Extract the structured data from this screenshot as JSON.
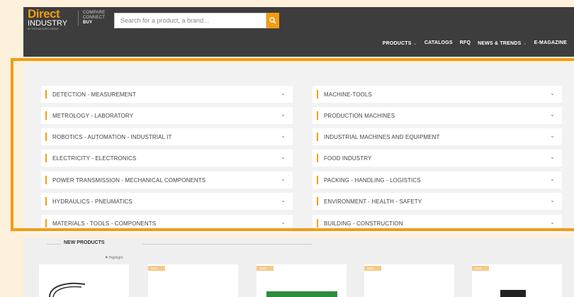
{
  "header": {
    "logo_line1": "Direct",
    "logo_line2": "INDUSTRY",
    "logo_line3": "BY VIRTUALEXPO GROUP",
    "tagline_1": "COMPARE",
    "tagline_2": "CONNECT",
    "tagline_3": "BUY",
    "search_placeholder": "Search for a product, a brand...",
    "nav": [
      {
        "label": "PRODUCTS",
        "has_dropdown": true
      },
      {
        "label": "CATALOGS",
        "has_dropdown": false
      },
      {
        "label": "RFQ",
        "has_dropdown": false
      },
      {
        "label": "NEWS & TRENDS",
        "has_dropdown": true
      },
      {
        "label": "E-MAGAZINE",
        "has_dropdown": false
      }
    ]
  },
  "categories_left": [
    "DETECTION - MEASUREMENT",
    "METROLOGY - LABORATORY",
    "ROBOTICS - AUTOMATION - INDUSTRIAL IT",
    "ELECTRICITY - ELECTRONICS",
    "POWER TRANSMISSION - MECHANICAL COMPONENTS",
    "HYDRAULICS - PNEUMATICS",
    "MATERIALS - TOOLS - COMPONENTS"
  ],
  "categories_right": [
    "MACHINE-TOOLS",
    "PRODUCTION MACHINES",
    "INDUSTRIAL MACHINES AND EQUIPMENT",
    "FOOD INDUSTRY",
    "PACKING - HANDLING - LOGISTICS",
    "ENVIRONMENT - HEALTH - SAFETY",
    "BUILDING - CONSTRUCTION"
  ],
  "new_products": {
    "title": "NEW PRODUCTS",
    "highlight_label": "Highlight",
    "badge": "NEW"
  },
  "colors": {
    "accent": "#f39c12",
    "header_bg": "#3d3d3d"
  }
}
